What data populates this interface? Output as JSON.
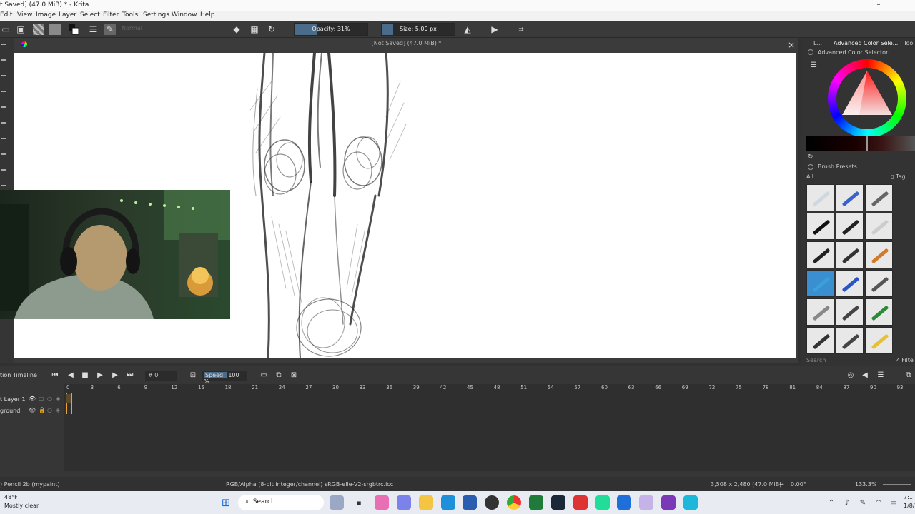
{
  "window": {
    "title": "t Saved]  (47.0 MiB) * - Krita",
    "minimize_icon": "minimize-icon",
    "maximize_icon": "maximize-icon"
  },
  "menu": [
    "Edit",
    "View",
    "Image",
    "Layer",
    "Select",
    "Filter",
    "Tools",
    "Settings",
    "Window",
    "Help"
  ],
  "toolbar": {
    "blend_mode": "Normal",
    "opacity_label": "Opacity: 31%",
    "opacity_value": 0.31,
    "size_label": "Size: 5.00 px"
  },
  "canvas": {
    "title": "[Not Saved]  (47.0 MiB) *",
    "close_icon": "close-icon"
  },
  "dockers": {
    "tab_l": "L...",
    "tab_color": "Advanced Color Sele...",
    "tab_tool": "Tool",
    "color_selector_title": "Advanced Color Selector",
    "brush_presets_title": "Brush Presets",
    "filter_all": "All",
    "tag_label": "Tag",
    "search_placeholder": "Search",
    "filter_label": "Filte"
  },
  "timeline": {
    "title": "tion Timeline",
    "frame_value": "0",
    "speed_label": "Speed:",
    "speed_value": "100 %",
    "ruler": [
      "0",
      "3",
      "6",
      "9",
      "12",
      "15",
      "18",
      "21",
      "24",
      "27",
      "30",
      "33",
      "36",
      "39",
      "42",
      "45",
      "48",
      "51",
      "54",
      "57",
      "60",
      "63",
      "66",
      "69",
      "72",
      "75",
      "78",
      "81",
      "84",
      "87",
      "90",
      "93"
    ],
    "layers": [
      "t Layer 1",
      "ground"
    ]
  },
  "status": {
    "brush": ") Pencil 2b (mypaint)",
    "color_space": "RGB/Alpha (8-bit integer/channel)  sRGB-elle-V2-srgbtrc.icc",
    "dimensions": "3,508 x 2,480 (47.0 MiB)",
    "rotation": "0.00°",
    "zoom": "133.3%"
  },
  "taskbar": {
    "weather_temp": "48°F",
    "weather_desc": "Mostly clear",
    "search": "Search",
    "clock_time": "7:1",
    "clock_date": "1/8/"
  }
}
